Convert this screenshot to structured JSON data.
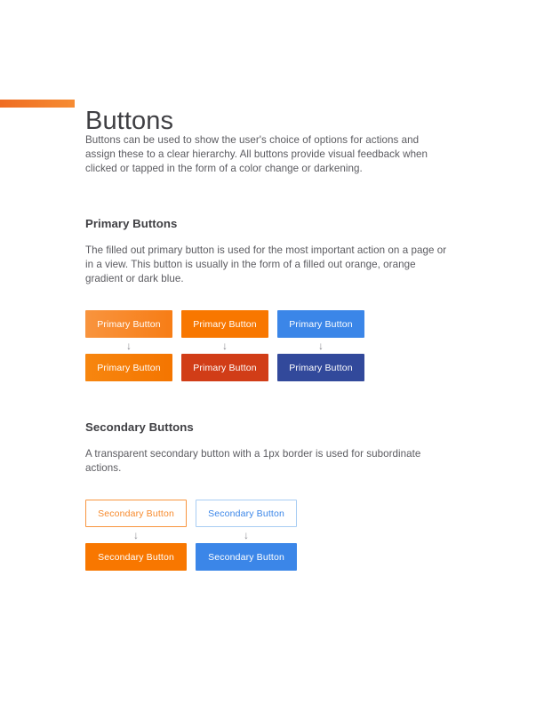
{
  "page": {
    "title": "Buttons",
    "accent_color": "#ef6c22",
    "accent_color_end": "#f68c33",
    "background": "#ffffff"
  },
  "intro": {
    "paragraph": "Buttons can be used to show the user's choice of options for actions and assign these to a clear hierarchy. All buttons provide visual feedback when clicked or tapped in the form of a color change or darkening."
  },
  "sections": [
    {
      "heading": "Primary Buttons",
      "paragraph": "The filled out primary button is used for the most important action on a page or in a view. This button is usually in the form of a filled out orange, orange gradient or dark blue.",
      "default_row": [
        {
          "label": "Primary Button",
          "style": "orange-gradient",
          "color": "#f8943e"
        },
        {
          "label": "Primary Button",
          "style": "orange",
          "color": "#f87700"
        },
        {
          "label": "Primary Button",
          "style": "blue",
          "color": "#3b86e8"
        }
      ],
      "arrows": [
        "↓",
        "↓",
        "↓"
      ],
      "pressed_row": [
        {
          "label": "Primary Button",
          "style": "orange-gradient-dark",
          "color": "#f7860f"
        },
        {
          "label": "Primary Button",
          "style": "orange-dark",
          "color": "#d13d17"
        },
        {
          "label": "Primary Button",
          "style": "blue-dark",
          "color": "#32499b"
        }
      ]
    },
    {
      "heading": "Secondary Buttons",
      "paragraph": "A transparent secondary button with a 1px border is used for subordinate actions.",
      "default_row": [
        {
          "label": "Secondary Button",
          "style": "outline-orange",
          "color": "#f78a2c"
        },
        {
          "label": "Secondary Button",
          "style": "outline-blue",
          "color": "#3b86e8"
        }
      ],
      "arrows": [
        "↓",
        "↓"
      ],
      "pressed_row": [
        {
          "label": "Secondary Button",
          "style": "orange",
          "color": "#f87700"
        },
        {
          "label": "Secondary Button",
          "style": "blue",
          "color": "#3b86e8"
        }
      ]
    }
  ]
}
